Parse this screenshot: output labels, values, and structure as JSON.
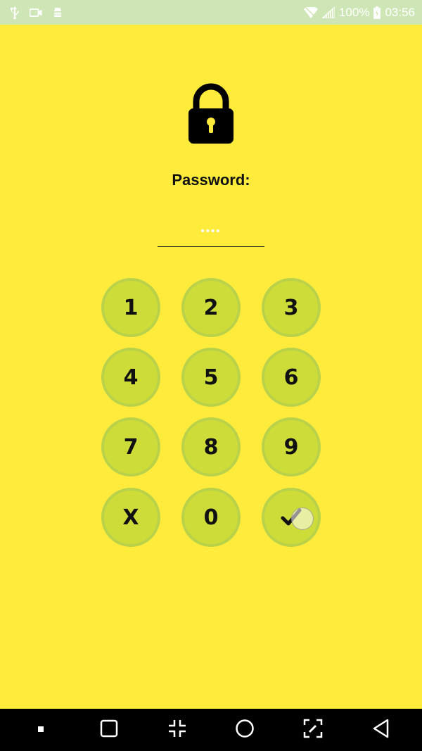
{
  "colors": {
    "status_bar_bg": "#cee6b5",
    "app_bg": "#ffeb3b",
    "key_fill": "#cddc39",
    "key_border": "#bad24a",
    "nav_bar_bg": "#000000"
  },
  "status_bar": {
    "left_icons": [
      "usb-icon",
      "video-camera-icon",
      "android-debug-icon"
    ],
    "right_icons": [
      "wifi-icon",
      "signal-icon",
      "battery-icon"
    ],
    "battery": "100%",
    "time": "03:56"
  },
  "lock_icon": "lock-icon",
  "password": {
    "label": "Password:",
    "value": "••••"
  },
  "keypad": {
    "keys": [
      {
        "label": "1"
      },
      {
        "label": "2"
      },
      {
        "label": "3"
      },
      {
        "label": "4"
      },
      {
        "label": "5"
      },
      {
        "label": "6"
      },
      {
        "label": "7"
      },
      {
        "label": "8"
      },
      {
        "label": "9"
      },
      {
        "label": "X"
      },
      {
        "label": "0"
      }
    ],
    "confirm_icon": "check-icon"
  },
  "nav_bar": {
    "buttons": [
      "stop-icon",
      "square-icon",
      "collapse-icon",
      "home-circle-icon",
      "edit-screen-icon",
      "back-triangle-icon"
    ]
  }
}
